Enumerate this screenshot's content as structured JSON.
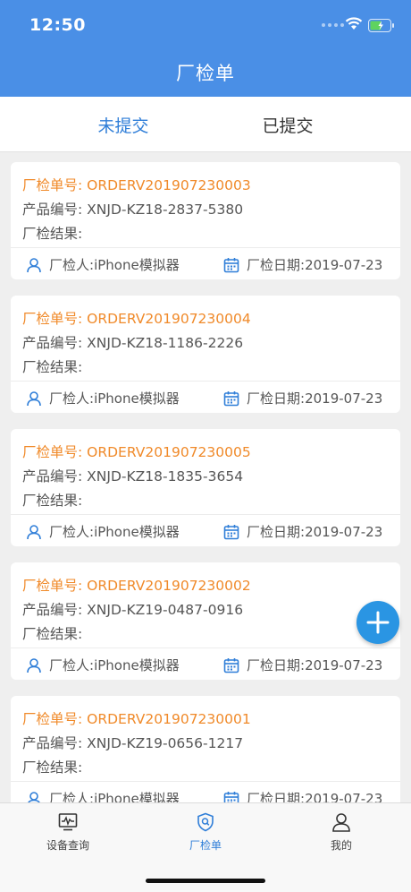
{
  "status_bar": {
    "time": "12:50"
  },
  "header": {
    "title": "厂检单"
  },
  "tabs": [
    {
      "label": "未提交",
      "active": true
    },
    {
      "label": "已提交",
      "active": false
    }
  ],
  "cards": [
    {
      "order_label": "厂检单号: ",
      "order_no": "ORDERV201907230003",
      "product_label": "产品编号: ",
      "product_no": "XNJD-KZ18-2837-5380",
      "result_label": "厂检结果:",
      "inspector_label": "厂检人: ",
      "inspector": "iPhone模拟器",
      "date_label": "厂检日期: ",
      "date": "2019-07-23"
    },
    {
      "order_label": "厂检单号: ",
      "order_no": "ORDERV201907230004",
      "product_label": "产品编号: ",
      "product_no": "XNJD-KZ18-1186-2226",
      "result_label": "厂检结果:",
      "inspector_label": "厂检人: ",
      "inspector": "iPhone模拟器",
      "date_label": "厂检日期: ",
      "date": "2019-07-23"
    },
    {
      "order_label": "厂检单号: ",
      "order_no": "ORDERV201907230005",
      "product_label": "产品编号: ",
      "product_no": "XNJD-KZ18-1835-3654",
      "result_label": "厂检结果:",
      "inspector_label": "厂检人: ",
      "inspector": "iPhone模拟器",
      "date_label": "厂检日期: ",
      "date": "2019-07-23"
    },
    {
      "order_label": "厂检单号: ",
      "order_no": "ORDERV201907230002",
      "product_label": "产品编号: ",
      "product_no": "XNJD-KZ19-0487-0916",
      "result_label": "厂检结果:",
      "inspector_label": "厂检人: ",
      "inspector": "iPhone模拟器",
      "date_label": "厂检日期: ",
      "date": "2019-07-23"
    },
    {
      "order_label": "厂检单号: ",
      "order_no": "ORDERV201907230001",
      "product_label": "产品编号: ",
      "product_no": "XNJD-KZ19-0656-1217",
      "result_label": "厂检结果:",
      "inspector_label": "厂检人: ",
      "inspector": "iPhone模拟器",
      "date_label": "厂检日期: ",
      "date": "2019-07-23"
    }
  ],
  "fab": {
    "icon": "plus-icon"
  },
  "tabbar": {
    "items": [
      {
        "label": "设备查询",
        "icon": "monitor-icon",
        "active": false
      },
      {
        "label": "厂检单",
        "icon": "shield-search-icon",
        "active": true
      },
      {
        "label": "我的",
        "icon": "person-icon",
        "active": false
      }
    ]
  },
  "colors": {
    "header": "#4a8fe6",
    "accent": "#2f7ed8",
    "order": "#f08a2a",
    "fab": "#2a95e3"
  }
}
